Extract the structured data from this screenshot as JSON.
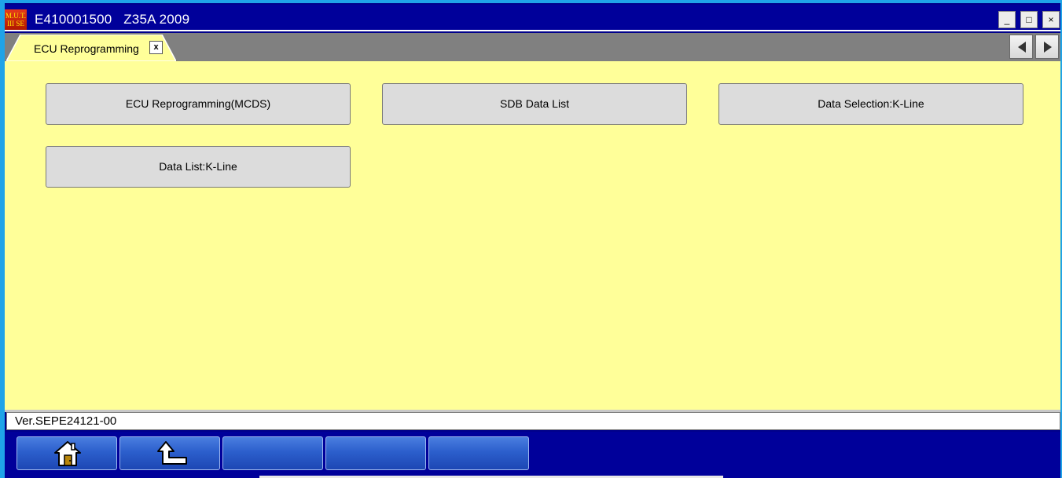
{
  "window": {
    "title": "E410001500   Z35A 2009",
    "logo_text_line1": "M.U.T.",
    "logo_text_line2": "III SE",
    "minimize_glyph": "_",
    "maximize_glyph": "□",
    "close_glyph": "×"
  },
  "tabs": [
    {
      "label": "ECU Reprogramming",
      "close_glyph": "x",
      "active": true
    }
  ],
  "menu": {
    "buttons": [
      {
        "label": "ECU Reprogramming(MCDS)"
      },
      {
        "label": "SDB Data List"
      },
      {
        "label": "Data Selection:K-Line"
      },
      {
        "label": "Data List:K-Line"
      }
    ]
  },
  "status": {
    "version": "Ver.SEPE24121-00"
  },
  "toolbar": {
    "buttons": [
      {
        "icon": "home-icon"
      },
      {
        "icon": "back-arrow-icon"
      },
      {
        "icon": ""
      },
      {
        "icon": ""
      },
      {
        "icon": ""
      }
    ]
  },
  "colors": {
    "title_bar": "#00009a",
    "content_background": "#ffff99",
    "tab_strip": "#808080",
    "toolbar_button": "#2c5fcc"
  }
}
